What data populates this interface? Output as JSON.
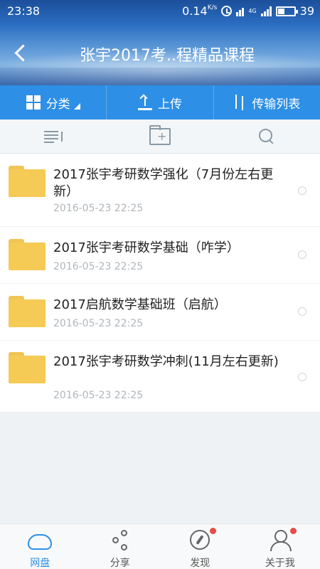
{
  "status_bar": {
    "time": "23:38",
    "speed": "0.14",
    "speed_unit": "K/s",
    "network": "4G",
    "battery": "39"
  },
  "header": {
    "title": "张宇2017考..程精品课程"
  },
  "actionbar": {
    "category_label": "分类",
    "upload_label": "上传",
    "transfer_label": "传输列表"
  },
  "files": [
    {
      "name": "2017张宇考研数学强化（7月份左右更新）",
      "date": "2016-05-23  22:25"
    },
    {
      "name": "2017张宇考研数学基础（咋学）",
      "date": "2016-05-23  22:25"
    },
    {
      "name": "2017启航数学基础班（启航）",
      "date": "2016-05-23  22:25"
    },
    {
      "name": "2017张宇考研数学冲刺(11月左右更新)",
      "date": "2016-05-23  22:25"
    }
  ],
  "bottomnav": {
    "items": [
      {
        "label": "网盘"
      },
      {
        "label": "分享"
      },
      {
        "label": "发现"
      },
      {
        "label": "关于我"
      }
    ]
  },
  "colors": {
    "accent": "#2d8fe6",
    "folder": "#f5ca55",
    "badge": "#e84a4a"
  }
}
